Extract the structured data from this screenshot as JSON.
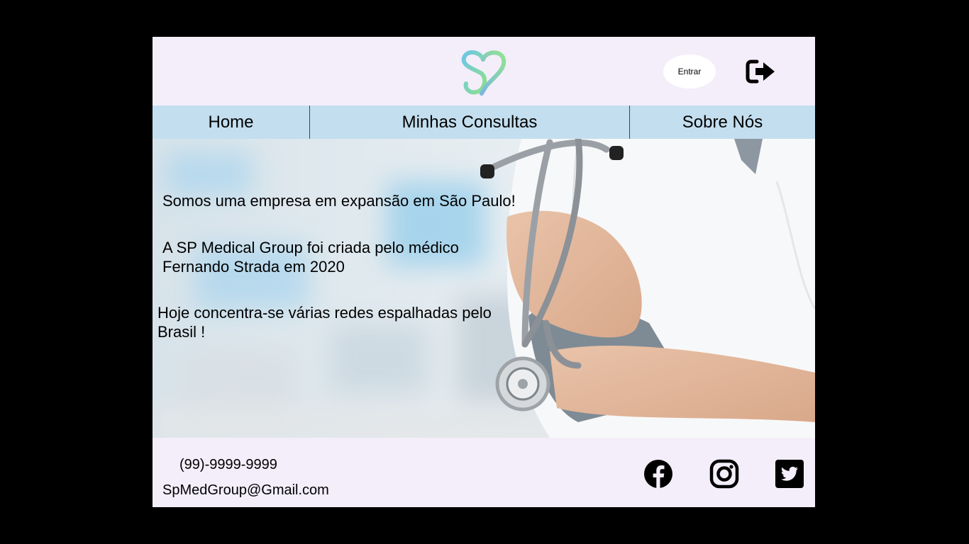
{
  "header": {
    "login_label": "Entrar",
    "logo_icon": "sp-heart-logo-icon",
    "logout_icon": "sign-out-icon",
    "colors": {
      "background": "#F3EEFA",
      "logo_gradient_start": "#7EC8E3",
      "logo_gradient_end": "#8EE08A"
    }
  },
  "nav": {
    "items": [
      {
        "label": "Home"
      },
      {
        "label": "Minhas Consultas"
      },
      {
        "label": "Sobre Nós"
      }
    ],
    "color": "#C3DEEE"
  },
  "hero": {
    "line1": "Somos uma empresa em expansão em São Paulo!",
    "line2": "A SP Medical Group foi criada pelo médico Fernando Strada em 2020",
    "line3": "Hoje concentra-se várias redes espalhadas pelo Brasil !",
    "image": "doctor-with-stethoscope-photo"
  },
  "footer": {
    "phone": "(99)-9999-9999",
    "email": "SpMedGroup@Gmail.com",
    "social": [
      "facebook-icon",
      "instagram-icon",
      "twitter-icon"
    ]
  }
}
